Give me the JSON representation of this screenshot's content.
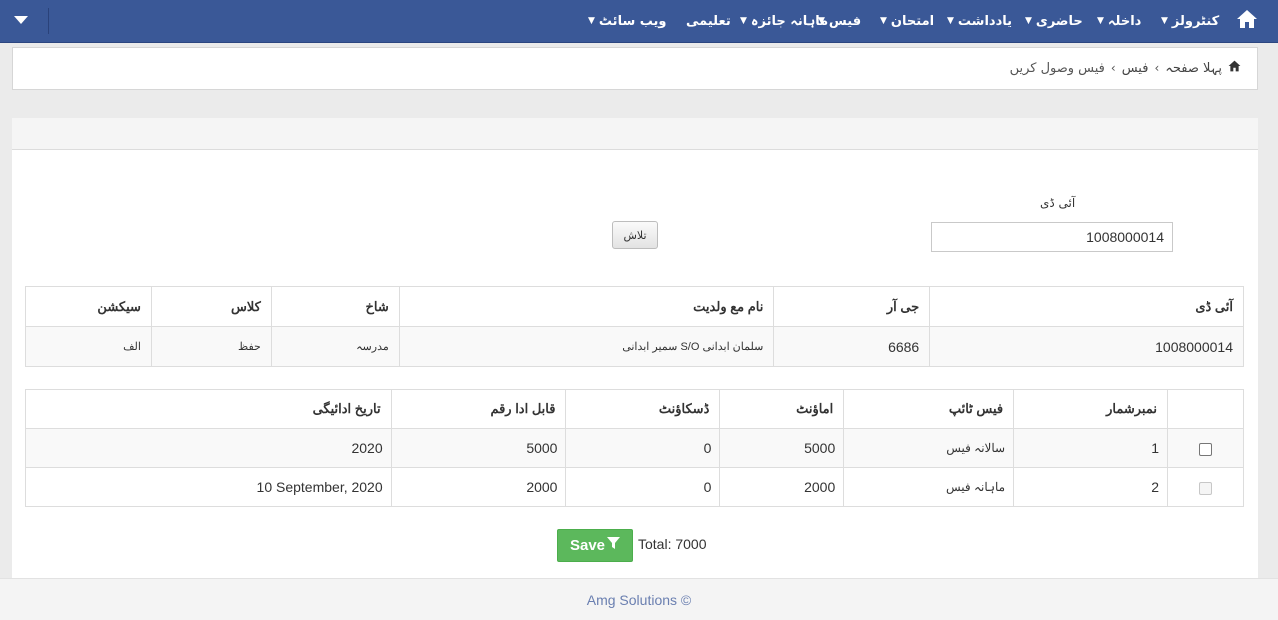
{
  "colors": {
    "navbar": "#3a5897",
    "save_button": "#5cb85c",
    "footer_text": "#6a7fb0"
  },
  "nav": {
    "toggle_icon": "caret-down-icon",
    "home_icon": "home-icon",
    "items": [
      {
        "label": "کنٹرولز"
      },
      {
        "label": "داخلہ"
      },
      {
        "label": "حاضری"
      },
      {
        "label": "یادداشت"
      },
      {
        "label": "امتحان"
      },
      {
        "label": "فیس"
      },
      {
        "label": "ماہانہ جائزہ"
      },
      {
        "label": "تعلیمی"
      },
      {
        "label": "ویب سائٹ"
      }
    ]
  },
  "breadcrumb": {
    "home": "پہلا صفحہ",
    "section": "فیس",
    "current": "فیس وصول کریں"
  },
  "search": {
    "label": "آئی ڈی",
    "value": "1008000014",
    "button": "تلاش"
  },
  "student_table": {
    "headers": [
      "آئی ڈی",
      "جی آر",
      "نام مع ولدیت",
      "شاخ",
      "کلاس",
      "سیکشن"
    ],
    "row": [
      "1008000014",
      "6686",
      "سمیر ابدانی S/O سلمان ابدانی",
      "مدرسہ",
      "حفظ",
      "الف"
    ]
  },
  "fee_table": {
    "headers": [
      "",
      "نمبرشمار",
      "فیس ٹائپ",
      "اماؤنٹ",
      "ڈسکاؤنٹ",
      "قابل ادا رقم",
      "تاریخ ادائیگی"
    ],
    "rows": [
      {
        "serial": "1",
        "type": "سالانہ فیس",
        "amount": "5000",
        "discount": "0",
        "payable": "5000",
        "date": "2020",
        "checked": false,
        "disabled": false
      },
      {
        "serial": "2",
        "type": "ماہانہ فیس",
        "amount": "2000",
        "discount": "0",
        "payable": "2000",
        "date": "10 September, 2020",
        "checked": false,
        "disabled": true
      }
    ]
  },
  "save": {
    "label": "Save",
    "icon": "filter-icon"
  },
  "total": "Total: 7000",
  "footer": "Amg Solutions ©"
}
